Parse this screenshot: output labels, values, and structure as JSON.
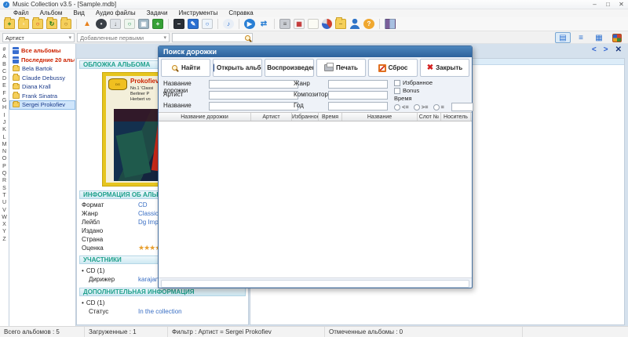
{
  "window": {
    "title": "Music Collection v3.5 - [Sample.mdb]",
    "controls": {
      "minimize": "–",
      "maximize": "□",
      "close": "✕"
    }
  },
  "menubar": {
    "items": [
      "Файл",
      "Альбом",
      "Вид",
      "Аудио файлы",
      "Задачи",
      "Инструменты",
      "Справка"
    ]
  },
  "toolbar": {
    "items": [
      {
        "name": "add-album",
        "cls": "ico-folder",
        "glyph": "+",
        "fg": "#1a7a1a"
      },
      {
        "name": "copy-album",
        "cls": "ico-folder",
        "glyph": "▫",
        "fg": "#ffffff"
      },
      {
        "name": "repair-album",
        "cls": "ico-folder",
        "glyph": "○",
        "fg": "#cc2222"
      },
      {
        "name": "refresh-album",
        "cls": "ico-folder",
        "glyph": "↻",
        "fg": "#1a7a1a"
      },
      {
        "name": "search-album",
        "cls": "ico-folder",
        "glyph": "○",
        "fg": "#8a5a10"
      },
      {
        "sep": true
      },
      {
        "name": "eject",
        "cls": "ico-plain",
        "glyph": "▲",
        "fg": "#e8821e"
      },
      {
        "name": "cd-info",
        "cls": "ico-circle",
        "glyph": "•",
        "fg": "#e0e0e0",
        "bg": "#3a3f46"
      },
      {
        "name": "download",
        "cls": "ico-box",
        "glyph": "↓",
        "fg": "#555555",
        "bg": "#dfe3e8"
      },
      {
        "name": "search-files",
        "cls": "ico-box",
        "glyph": "○",
        "fg": "#1a8a4a",
        "bg": "#eef6ee"
      },
      {
        "name": "images",
        "cls": "ico-box",
        "glyph": "▣",
        "fg": "#ffffff",
        "bg": "#9fb6c4"
      },
      {
        "name": "add-item",
        "cls": "ico-box",
        "glyph": "+",
        "fg": "#ffffff",
        "bg": "#35a035"
      },
      {
        "sep": true
      },
      {
        "name": "remove",
        "cls": "ico-box",
        "glyph": "–",
        "fg": "#ffffff",
        "bg": "#2a2f36"
      },
      {
        "name": "edit",
        "cls": "ico-box",
        "glyph": "✎",
        "fg": "#ffffff",
        "bg": "#2a6fd0"
      },
      {
        "name": "preview",
        "cls": "ico-box",
        "glyph": "○",
        "fg": "#2a6fd0",
        "bg": "#eef4fa"
      },
      {
        "sep": true
      },
      {
        "name": "audio-search",
        "cls": "ico-circle",
        "glyph": "♪",
        "fg": "#2a6fd0",
        "bg": "#e8eef6"
      },
      {
        "sep": true
      },
      {
        "name": "play",
        "cls": "ico-circle",
        "glyph": "▶",
        "fg": "#ffffff",
        "bg": "#2a7fd4"
      },
      {
        "name": "shuffle",
        "cls": "ico-plain",
        "glyph": "⇄",
        "fg": "#2a7fd4"
      },
      {
        "sep": true
      },
      {
        "name": "print",
        "cls": "ico-box",
        "glyph": "≡",
        "fg": "#555555",
        "bg": "#c9ccd2"
      },
      {
        "name": "schedule",
        "cls": "ico-box",
        "glyph": "▦",
        "fg": "#c23030",
        "bg": "#f5f5f5"
      },
      {
        "name": "document",
        "cls": "ico-box",
        "glyph": "",
        "fg": "#888888",
        "bg": "#fbfbf4"
      },
      {
        "name": "pie-chart",
        "cls": "ico-pie",
        "glyph": ""
      },
      {
        "name": "folder",
        "cls": "ico-folder",
        "glyph": "–",
        "fg": "#9a7a20"
      },
      {
        "name": "user",
        "cls": "ico-person",
        "glyph": ""
      },
      {
        "name": "help",
        "cls": "ico-circle",
        "glyph": "?",
        "fg": "#ffffff",
        "bg": "#f0a830"
      },
      {
        "sep": true
      },
      {
        "name": "exit",
        "cls": "ico-exit",
        "glyph": ""
      }
    ]
  },
  "filterbar": {
    "field_select": "Артист",
    "sort_select": "Добавленные первыми",
    "search_placeholder": "",
    "dropdown_arrow": "▾"
  },
  "view_switcher": {
    "buttons": [
      {
        "name": "card-view",
        "glyph": "▤",
        "active": true
      },
      {
        "name": "list-view",
        "glyph": "≡",
        "active": false
      },
      {
        "name": "grid-view",
        "glyph": "▦",
        "active": false
      },
      {
        "name": "tile-view",
        "glyph": "",
        "active": false,
        "tile": true
      }
    ]
  },
  "alphabet": [
    "#",
    "A",
    "B",
    "C",
    "D",
    "E",
    "F",
    "G",
    "H",
    "I",
    "J",
    "K",
    "L",
    "M",
    "N",
    "O",
    "P",
    "Q",
    "R",
    "S",
    "T",
    "U",
    "V",
    "W",
    "X",
    "Y",
    "Z"
  ],
  "artist_tree": {
    "items": [
      {
        "label": "Все альбомы",
        "type": "special"
      },
      {
        "label": "Последние 20 альбо...",
        "type": "special"
      },
      {
        "label": "Bela Bartok",
        "type": "artist"
      },
      {
        "label": "Claude Debussy",
        "type": "artist"
      },
      {
        "label": "Diana Krall",
        "type": "artist"
      },
      {
        "label": "Frank Sinatra",
        "type": "artist"
      },
      {
        "label": "Sergei Prokofiev",
        "type": "artist",
        "selected": true
      }
    ]
  },
  "album_panel": {
    "cover_header": "ОБЛОЖКА АЛЬБОМА",
    "cover": {
      "logo": "DG",
      "artist": "Prokofiev",
      "line1": "No.1 'Classi",
      "line2": "Berliner P",
      "line3": "Herbert vo"
    },
    "info_header": "ИНФОРМАЦИЯ ОБ АЛЬБОМЕ",
    "info_rows": [
      {
        "label": "Формат",
        "value": "CD",
        "link": true
      },
      {
        "label": "Жанр",
        "value": "Classical music",
        "link": true
      },
      {
        "label": "Лейбл",
        "value": "Dg Imports",
        "link": true
      },
      {
        "label": "Издано",
        "value": ""
      },
      {
        "label": "Страна",
        "value": ""
      },
      {
        "label": "Оценка",
        "value": "",
        "stars": {
          "filled": 6,
          "total": 7
        }
      }
    ],
    "participants_header": "УЧАСТНИКИ",
    "participants_group": "CD (1)",
    "participants_label": "Дирижер",
    "participants_value": "karajan Herb",
    "additional_header": "ДОПОЛНИТЕЛЬНАЯ ИНФОРМАЦИЯ",
    "additional_group": "CD (1)",
    "additional_label": "Статус",
    "additional_value": "In the collection"
  },
  "track_panel": {
    "nav_back": "<",
    "nav_forward": ">",
    "nav_close": "✕"
  },
  "dialog": {
    "title": "Поиск дорожки",
    "buttons": [
      {
        "label": "Найти",
        "icon": "search-icon"
      },
      {
        "label": "Открыть альбом",
        "icon": "open-album-icon"
      },
      {
        "label": "Воспроизведение",
        "icon": "play-icon"
      },
      {
        "label": "Печать",
        "icon": "print-icon"
      },
      {
        "label": "Сброс",
        "icon": "reset-icon"
      },
      {
        "label": "Закрыть",
        "icon": "close-icon"
      }
    ],
    "form": {
      "left": [
        {
          "label": "Название дорожки",
          "value": ""
        },
        {
          "label": "Артист",
          "value": ""
        },
        {
          "label": "Название",
          "value": ""
        }
      ],
      "middle": [
        {
          "label": "Жанр",
          "value": ""
        },
        {
          "label": "Композитор",
          "value": ""
        },
        {
          "label": "Год",
          "value": ""
        }
      ],
      "checkboxes": [
        {
          "label": "Избранное",
          "checked": false
        },
        {
          "label": "Bonus",
          "checked": false
        }
      ],
      "time": {
        "label": "Время",
        "options": [
          "<=",
          ">=",
          "="
        ],
        "value": ""
      }
    },
    "table": {
      "columns": [
        "Название дорожки",
        "Артист",
        "Избранное",
        "Время",
        "Название",
        "Слот №",
        "Носитель"
      ]
    }
  },
  "statusbar": {
    "items": [
      "Всего альбомов : 5",
      "Загруженные : 1",
      "Фильтр : Артист = Sergei Prokofiev",
      "Отмеченные альбомы : 0"
    ]
  },
  "colors": {
    "accent": "#2a6fd0",
    "dialog_title_bar": "#35689e",
    "section_header_text": "#1fa08c",
    "link": "#3a6fc4",
    "special_item": "#cc2200",
    "star": "#e8a030"
  }
}
